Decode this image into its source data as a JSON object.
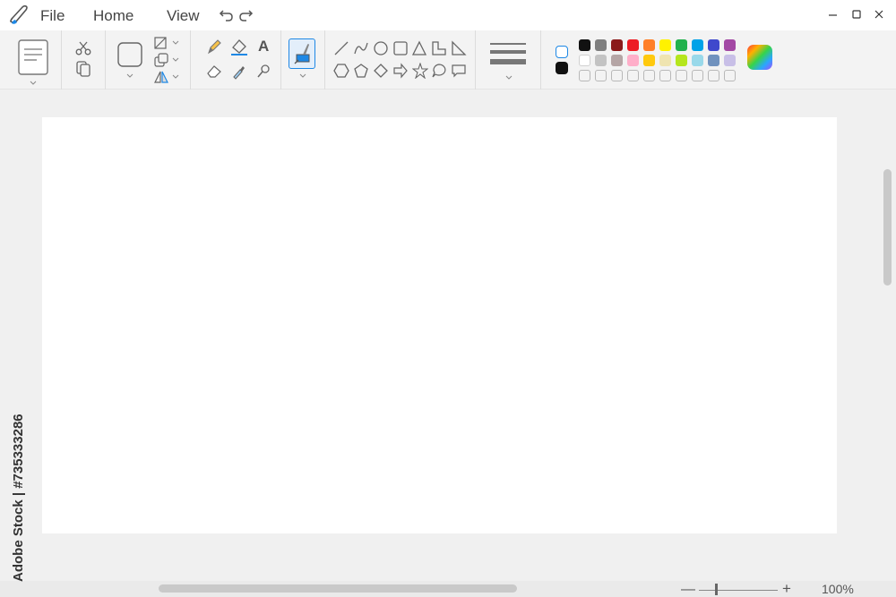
{
  "menu": {
    "file": "File",
    "home": "Home",
    "view": "View"
  },
  "icons": {
    "app": "paint-brush-icon",
    "undo": "undo-icon",
    "redo": "redo-icon",
    "minimize": "minimize-icon",
    "maximize": "maximize-icon",
    "close": "close-icon",
    "text_tool": "A"
  },
  "colors": {
    "accent": "#1e88e5",
    "palette_row1": [
      "#111111",
      "#7f7f7f",
      "#8b1a1a",
      "#ed1c24",
      "#ff7f27",
      "#fff200",
      "#22b14c",
      "#00a2e8",
      "#3f48cc",
      "#a349a4"
    ],
    "palette_row2": [
      "#ffffff",
      "#c3c3c3",
      "#b5a5a5",
      "#ffaec9",
      "#ffc90e",
      "#efe4b0",
      "#b5e61d",
      "#99d9ea",
      "#7092be",
      "#c8bfe7"
    ],
    "primary": "#ffffff",
    "secondary": "#111111"
  },
  "zoom": {
    "minus": "—",
    "plus": "+",
    "value": "100%"
  },
  "watermark": "Adobe Stock | #735333286"
}
